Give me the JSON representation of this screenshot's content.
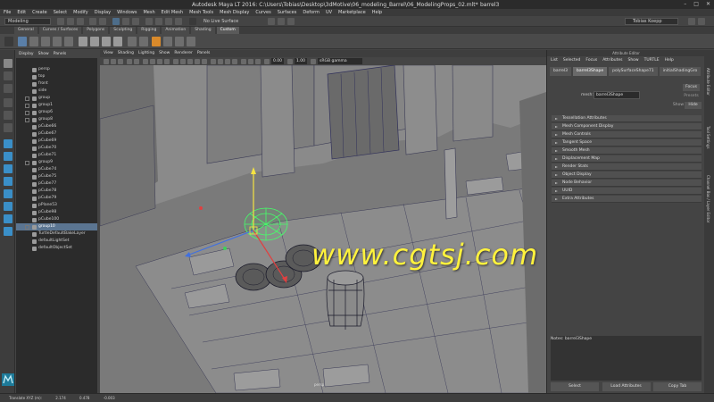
{
  "window": {
    "title": "Autodesk Maya LT 2016: C:\\Users\\Tobias\\Desktop\\3dMotive\\06_modeling_Barrel\\06_ModelingProps_02.mlt*",
    "object": "barrel3",
    "controls": [
      "–",
      "□",
      "✕"
    ]
  },
  "menubar": [
    "File",
    "Edit",
    "Create",
    "Select",
    "Modify",
    "Display",
    "Windows",
    "Mesh",
    "Edit Mesh",
    "Mesh Tools",
    "Mesh Display",
    "Curves",
    "Surfaces",
    "Deform",
    "UV",
    "Marketplace",
    "Help"
  ],
  "statusline": {
    "mode": "Modeling",
    "live_surface": "No Live Surface",
    "user": "Tobias Koepp"
  },
  "shelf": {
    "tabs": [
      "General",
      "Curves / Surfaces",
      "Polygons",
      "Sculpting",
      "Rigging",
      "Animation",
      "Shading",
      "Custom"
    ],
    "active_tab": "Custom"
  },
  "outliner": {
    "menu": [
      "Display",
      "Show",
      "Panels"
    ],
    "items": [
      {
        "label": "persp",
        "expandable": false
      },
      {
        "label": "top",
        "expandable": false
      },
      {
        "label": "front",
        "expandable": false
      },
      {
        "label": "side",
        "expandable": false
      },
      {
        "label": "group",
        "expandable": true
      },
      {
        "label": "group1",
        "expandable": true
      },
      {
        "label": "group6",
        "expandable": true
      },
      {
        "label": "group8",
        "expandable": true
      },
      {
        "label": "pCube66",
        "expandable": false
      },
      {
        "label": "pCube67",
        "expandable": false
      },
      {
        "label": "pCube69",
        "expandable": false
      },
      {
        "label": "pCube70",
        "expandable": false
      },
      {
        "label": "pCube71",
        "expandable": false
      },
      {
        "label": "group9",
        "expandable": true
      },
      {
        "label": "pCube74",
        "expandable": false
      },
      {
        "label": "pCube75",
        "expandable": false
      },
      {
        "label": "pCube77",
        "expandable": false
      },
      {
        "label": "pCube78",
        "expandable": false
      },
      {
        "label": "pCube79",
        "expandable": false
      },
      {
        "label": "pPlane53",
        "expandable": false
      },
      {
        "label": "pCube98",
        "expandable": false
      },
      {
        "label": "pCube100",
        "expandable": false
      },
      {
        "label": "group10",
        "expandable": true,
        "selected": true
      },
      {
        "label": "TurtleDefaultBakeLayer",
        "expandable": false
      },
      {
        "label": "defaultLightSet",
        "expandable": false
      },
      {
        "label": "defaultObjectSet",
        "expandable": false
      }
    ]
  },
  "viewport": {
    "menu": [
      "View",
      "Shading",
      "Lighting",
      "Show",
      "Renderer",
      "Panels"
    ],
    "near": "0.00",
    "far": "1.00",
    "colorspace": "sRGB gamma",
    "camera": "persp",
    "watermark": "www.cgtsj.com"
  },
  "attribute_editor": {
    "title": "Attribute Editor",
    "menu": [
      "List",
      "Selected",
      "Focus",
      "Attributes",
      "Show",
      "TURTLE",
      "Help"
    ],
    "tabs": [
      "barrel3",
      "barrel3Shape",
      "polySurfaceShape71",
      "initialShadingGro"
    ],
    "active_tab": "barrel3Shape",
    "mesh_label": "mesh:",
    "mesh_value": "barrel3Shape",
    "buttons": [
      "Focus",
      "Presets",
      "Show",
      "Hide"
    ],
    "sections": [
      "Tessellation Attributes",
      "Mesh Component Display",
      "Mesh Controls",
      "Tangent Space",
      "Smooth Mesh",
      "Displacement Map",
      "Render Stats",
      "Object Display",
      "Node Behavior",
      "UUID",
      "Extra Attributes"
    ],
    "notes_label": "Notes:",
    "notes_value": "barrel3Shape",
    "bottom_buttons": [
      "Select",
      "Load Attributes",
      "Copy Tab"
    ]
  },
  "side_tabs": [
    "Attribute Editor",
    "Tool Settings",
    "Channel Box / Layer Editor"
  ],
  "bottom": {
    "translate_label": "Translate XYZ (m):",
    "x": "2.174",
    "y": "0.478",
    "z": "-0.003"
  },
  "colors": {
    "selection": "#5b7591",
    "gizmo_y": "#f5e342",
    "gizmo_x": "#e04040",
    "gizmo_z": "#4070e0",
    "barrel_selected": "#46ff6a",
    "watermark": "#fff23d"
  }
}
